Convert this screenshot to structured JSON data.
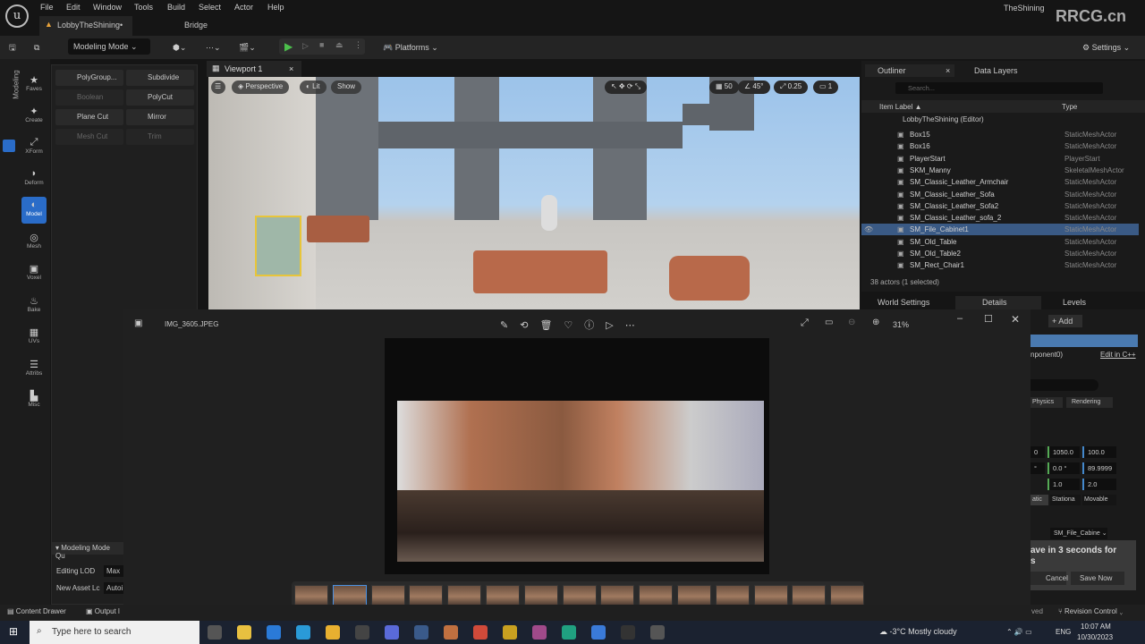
{
  "app": {
    "menu": [
      "File",
      "Edit",
      "Window",
      "Tools",
      "Build",
      "Select",
      "Actor",
      "Help"
    ],
    "project": "TheShining",
    "doc_tab": "LobbyTheShining•",
    "bridge_tab": "Bridge"
  },
  "toolbar": {
    "mode": "Modeling Mode",
    "platforms": "Platforms",
    "settings": "Settings"
  },
  "sidebar": {
    "vertical_label": "Modeling",
    "items": [
      "Faves",
      "Create",
      "XForm",
      "Deform",
      "Model",
      "Mesh",
      "Voxel",
      "Bake",
      "UVs",
      "Attribs",
      "Misc"
    ],
    "active": "Model"
  },
  "tools": [
    {
      "label": "PolyGroup...",
      "enabled": true
    },
    {
      "label": "Subdivide",
      "enabled": true
    },
    {
      "label": "Boolean",
      "enabled": false
    },
    {
      "label": "PolyCut",
      "enabled": true
    },
    {
      "label": "Plane Cut",
      "enabled": true
    },
    {
      "label": "Mirror",
      "enabled": true
    },
    {
      "label": "Mesh Cut",
      "enabled": false
    },
    {
      "label": "Trim",
      "enabled": false
    }
  ],
  "quick": {
    "header": "Modeling Mode Qu",
    "editing_lod_label": "Editing LOD",
    "editing_lod_value": "Max",
    "new_asset_label": "New Asset Lc",
    "new_asset_value": "Autoi"
  },
  "bottom": {
    "content_drawer": "Content Drawer",
    "output_log": "Output l",
    "saved": "ved",
    "revision": "Revision Control"
  },
  "viewport": {
    "tab": "Viewport 1",
    "perspective": "Perspective",
    "lit": "Lit",
    "show": "Show",
    "grid": "50",
    "angle": "45°",
    "scale": "0.25",
    "camera": "1"
  },
  "outliner": {
    "tab": "Outliner",
    "tab2": "Data Layers",
    "search_placeholder": "Search...",
    "col_label": "Item Label ▲",
    "col_type": "Type",
    "root": "LobbyTheShining (Editor)",
    "rows": [
      [
        "Box15",
        "StaticMeshActor"
      ],
      [
        "Box16",
        "StaticMeshActor"
      ],
      [
        "PlayerStart",
        "PlayerStart"
      ],
      [
        "SKM_Manny",
        "SkeletalMeshActor"
      ],
      [
        "SM_Classic_Leather_Armchair",
        "StaticMeshActor"
      ],
      [
        "SM_Classic_Leather_Sofa",
        "StaticMeshActor"
      ],
      [
        "SM_Classic_Leather_Sofa2",
        "StaticMeshActor"
      ],
      [
        "SM_Classic_Leather_sofa_2",
        "StaticMeshActor"
      ],
      [
        "SM_File_Cabinet1",
        "StaticMeshActor"
      ],
      [
        "SM_Old_Table",
        "StaticMeshActor"
      ],
      [
        "SM_Old_Table2",
        "StaticMeshActor"
      ],
      [
        "SM_Rect_Chair1",
        "StaticMeshActor"
      ]
    ],
    "selected": "SM_File_Cabinet1",
    "status": "38 actors (1 selected)"
  },
  "panel_tabs": [
    "World Settings",
    "Details",
    "Levels"
  ],
  "details": {
    "add": "+ Add",
    "component": "nponent0)",
    "edit_cpp": "Edit in C++",
    "tabs": [
      "Physics",
      "Rendering"
    ],
    "loc": [
      "0",
      "1050.0",
      "100.0"
    ],
    "rot": [
      "°",
      "0.0 °",
      "89.9999"
    ],
    "scale": [
      "",
      "1.0",
      "2.0"
    ],
    "mobility": [
      "atic",
      "Stationa",
      "Movable"
    ],
    "mesh": "SM_File_Cabine",
    "toast": "ave in 3 seconds for",
    "toast2": "s",
    "cancel": "Cancel",
    "save_now": "Save Now"
  },
  "photo": {
    "filename": "IMG_3605.JPEG",
    "zoom": "31%"
  },
  "taskbar": {
    "search_placeholder": "Type here to search",
    "weather": "-3°C  Mostly cloudy",
    "lang": "ENG",
    "time": "10:07 AM",
    "date": "10/30/2023"
  },
  "watermark": "RRCG.cn"
}
